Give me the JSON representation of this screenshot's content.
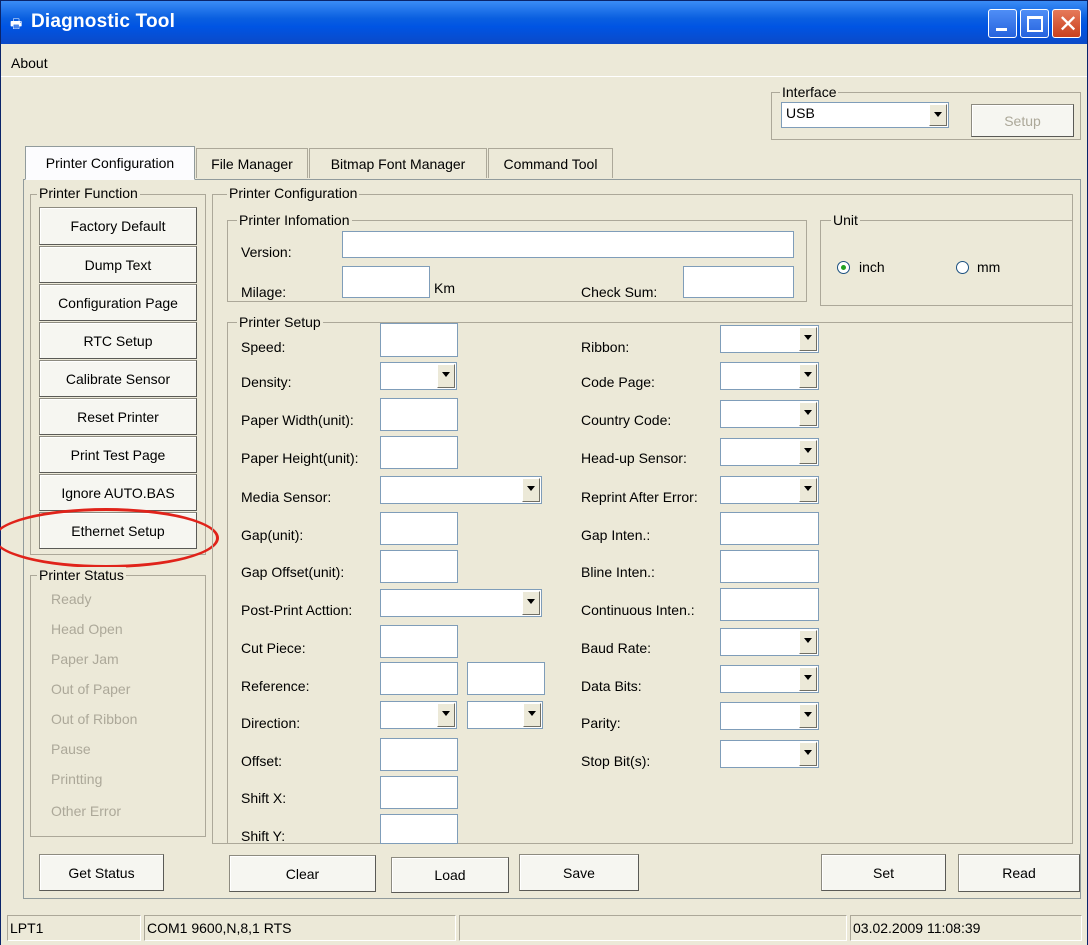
{
  "window": {
    "title": "Diagnostic Tool"
  },
  "menu": {
    "about": "About"
  },
  "interface": {
    "title": "Interface",
    "value": "USB",
    "setup": "Setup"
  },
  "tabs": [
    "Printer Configuration",
    "File Manager",
    "Bitmap Font Manager",
    "Command Tool"
  ],
  "printer_function": {
    "title": "Printer Function",
    "buttons": [
      "Factory Default",
      "Dump Text",
      "Configuration Page",
      "RTC Setup",
      "Calibrate Sensor",
      "Reset Printer",
      "Print Test Page",
      "Ignore AUTO.BAS",
      "Ethernet Setup"
    ]
  },
  "printer_status": {
    "title": "Printer Status",
    "items": [
      "Ready",
      "Head Open",
      "Paper Jam",
      "Out of Paper",
      "Out of Ribbon",
      "Pause",
      "Printting",
      "Other Error"
    ],
    "get_status": "Get Status"
  },
  "config": {
    "title": "Printer Configuration",
    "info": {
      "title": "Printer Infomation",
      "version": "Version:",
      "milage": "Milage:",
      "km": "Km",
      "checksum": "Check Sum:"
    },
    "unit": {
      "title": "Unit",
      "inch": "inch",
      "mm": "mm",
      "selected": "inch"
    },
    "setup": {
      "title": "Printer Setup",
      "left": [
        "Speed:",
        "Density:",
        "Paper Width(unit):",
        "Paper Height(unit):",
        "Media Sensor:",
        "Gap(unit):",
        "Gap Offset(unit):",
        "Post-Print Acttion:",
        "Cut Piece:",
        "Reference:",
        "Direction:",
        "Offset:",
        "Shift X:",
        "Shift Y:"
      ],
      "right": [
        "Ribbon:",
        "Code Page:",
        "Country Code:",
        "Head-up Sensor:",
        "Reprint After Error:",
        "Gap Inten.:",
        "Bline Inten.:",
        "Continuous Inten.:",
        "Baud Rate:",
        "Data Bits:",
        "Parity:",
        "Stop Bit(s):"
      ]
    },
    "buttons": {
      "clear": "Clear",
      "load": "Load",
      "save": "Save",
      "set": "Set",
      "read": "Read"
    }
  },
  "statusbar": {
    "port": "LPT1",
    "com": "COM1 9600,N,8,1 RTS",
    "middle": "",
    "datetime": "03.02.2009 11:08:39"
  }
}
